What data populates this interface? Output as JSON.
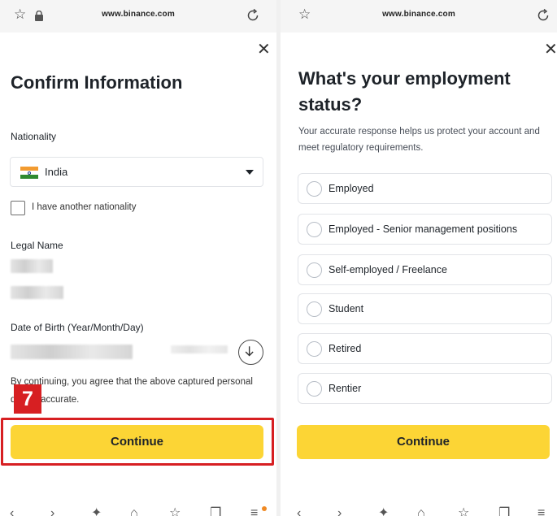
{
  "browser": {
    "url": "www.binance.com"
  },
  "left": {
    "title": "Confirm Information",
    "nationality_label": "Nationality",
    "nationality_value": "India",
    "another_nationality_label": "I have another nationality",
    "legal_name_label": "Legal Name",
    "dob_label": "Date of Birth (Year/Month/Day)",
    "disclaimer": "By continuing, you agree that the above captured personal data is accurate.",
    "step_number": "7",
    "continue_label": "Continue",
    "highlight_color": "#d71f22"
  },
  "right": {
    "title": "What's your employment status?",
    "subtitle": "Your accurate response helps us protect your account and meet regulatory requirements.",
    "options": [
      {
        "label": "Employed"
      },
      {
        "label": "Employed - Senior management positions"
      },
      {
        "label": "Self-employed / Freelance"
      },
      {
        "label": "Student"
      },
      {
        "label": "Retired"
      },
      {
        "label": "Rentier"
      }
    ],
    "continue_label": "Continue"
  },
  "theme": {
    "accent": "#fcd535",
    "text": "#1e2329",
    "border": "#e2e4e8"
  },
  "icons": {
    "star": "star-icon",
    "lock": "lock-icon",
    "reload": "reload-icon",
    "close": "close-icon",
    "dropdown": "caret-down-icon",
    "download": "download-icon"
  }
}
